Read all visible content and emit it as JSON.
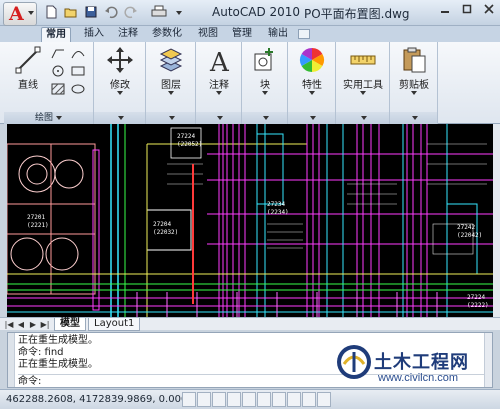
{
  "titlebar": {
    "app_name": "AutoCAD 2010",
    "file_name": "PO平面布置图.dwg"
  },
  "tabs": [
    {
      "label": "常用",
      "active": true
    },
    {
      "label": "插入",
      "active": false
    },
    {
      "label": "注释",
      "active": false
    },
    {
      "label": "参数化",
      "active": false
    },
    {
      "label": "视图",
      "active": false
    },
    {
      "label": "管理",
      "active": false
    },
    {
      "label": "输出",
      "active": false
    }
  ],
  "ribbon": {
    "draw_panel_title": "绘图",
    "line_label": "直线",
    "modify_label": "修改",
    "layers_label": "图层",
    "annotation_label": "注释",
    "block_label": "块",
    "properties_label": "特性",
    "utilities_label": "实用工具",
    "clipboard_label": "剪贴板"
  },
  "drawing": {
    "room_labels": [
      "27201",
      "(2221)",
      "27204",
      "(22032)",
      "27224",
      "(22052)",
      "27234",
      "(2234)",
      "27242",
      "(22042)",
      "27224",
      "(2222)"
    ]
  },
  "layout_tabs": {
    "model": "模型",
    "layout1": "Layout1"
  },
  "command": {
    "lines": [
      "正在重生成模型。",
      "命令: find",
      "正在重生成模型。"
    ],
    "prompt": "命令:"
  },
  "statusbar": {
    "coords": "462288.2608, 4172839.9869, 0.0000"
  },
  "watermark": {
    "title": "土木工程网",
    "url": "www.civilcn.com"
  },
  "colors": {
    "canvas_bg": "#000000",
    "accent_red": "#d51f1f",
    "line_magenta": "#ff3cff",
    "line_cyan": "#36e8ff",
    "line_green": "#37ff4a",
    "line_yellow": "#f1f15a"
  }
}
